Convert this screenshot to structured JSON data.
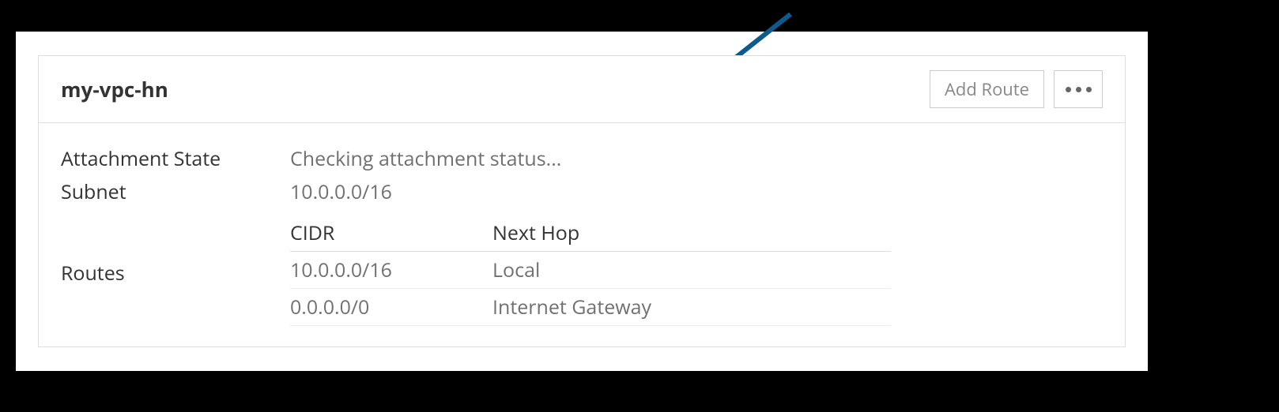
{
  "panel": {
    "title": "my-vpc-hn",
    "actions": {
      "add_route": "Add Route"
    },
    "fields": {
      "attachment_state_label": "Attachment State",
      "attachment_state_value": "Checking attachment status...",
      "subnet_label": "Subnet",
      "subnet_value": "10.0.0.0/16",
      "routes_label": "Routes"
    },
    "routes": {
      "columns": {
        "cidr": "CIDR",
        "next_hop": "Next Hop"
      },
      "rows": [
        {
          "cidr": "10.0.0.0/16",
          "next_hop": "Local"
        },
        {
          "cidr": "0.0.0.0/0",
          "next_hop": "Internet Gateway"
        }
      ]
    }
  },
  "colors": {
    "arrow": "#0d5a8c"
  }
}
